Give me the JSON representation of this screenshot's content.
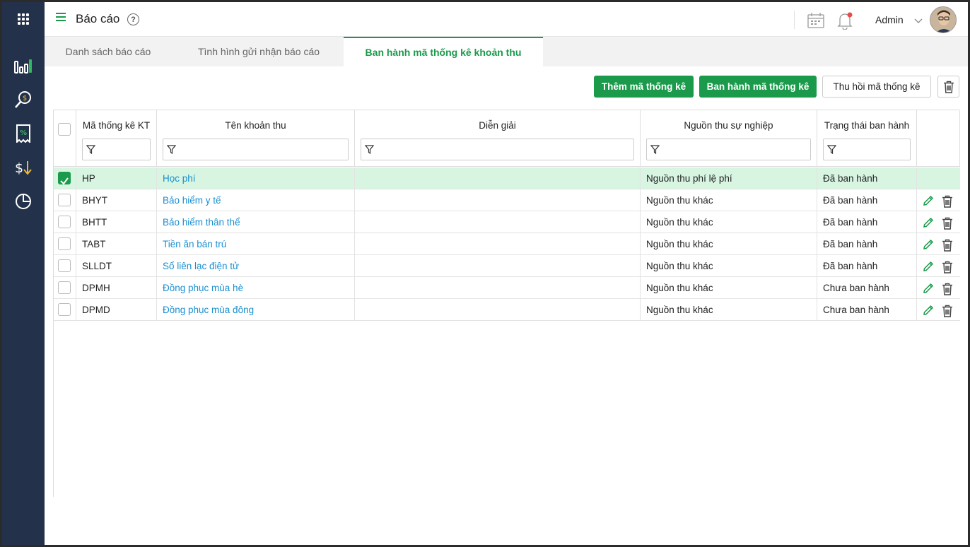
{
  "header": {
    "title": "Báo cáo",
    "help_symbol": "?",
    "user": "Admin"
  },
  "sidebar": {
    "items": [
      "apps-icon",
      "bar-chart-icon",
      "search-money-icon",
      "percent-receipt-icon",
      "dollar-down-icon",
      "pie-chart-icon"
    ]
  },
  "tabs": [
    {
      "label": "Danh sách báo cáo",
      "active": false
    },
    {
      "label": "Tình hình gửi nhận báo cáo",
      "active": false
    },
    {
      "label": "Ban hành mã thống kê khoản thu",
      "active": true
    }
  ],
  "toolbar": {
    "add_label": "Thêm mã thống kê",
    "publish_label": "Ban hành mã thống kê",
    "revoke_label": "Thu hồi mã thống kê"
  },
  "table": {
    "columns": [
      "Mã thống kê KT",
      "Tên khoản thu",
      "Diễn giải",
      "Nguồn thu sự nghiệp",
      "Trạng thái ban hành"
    ],
    "rows": [
      {
        "code": "HP",
        "name": "Học phí",
        "desc": "",
        "source": "Nguồn thu phí lệ phí",
        "status": "Đã ban hành",
        "checked": true
      },
      {
        "code": "BHYT",
        "name": "Bảo hiểm y tế",
        "desc": "",
        "source": "Nguồn thu khác",
        "status": "Đã ban hành",
        "checked": false
      },
      {
        "code": "BHTT",
        "name": "Bảo hiểm thân thể",
        "desc": "",
        "source": "Nguồn thu khác",
        "status": "Đã ban hành",
        "checked": false
      },
      {
        "code": "TABT",
        "name": "Tiền ăn bán trú",
        "desc": "",
        "source": "Nguồn thu khác",
        "status": "Đã ban hành",
        "checked": false
      },
      {
        "code": "SLLDT",
        "name": "Sổ liên lạc điện tử",
        "desc": "",
        "source": "Nguồn thu khác",
        "status": "Đã ban hành",
        "checked": false
      },
      {
        "code": "DPMH",
        "name": "Đồng phục mùa hè",
        "desc": "",
        "source": "Nguồn thu khác",
        "status": "Chưa ban hành",
        "checked": false
      },
      {
        "code": "DPMD",
        "name": "Đồng phục mùa đông",
        "desc": "",
        "source": "Nguồn thu khác",
        "status": "Chưa ban hành",
        "checked": false
      }
    ]
  },
  "colors": {
    "accent": "#1a9a4a",
    "link": "#1a8fd0",
    "sidebar": "#23324a",
    "selected_row": "#d7f5e1"
  }
}
